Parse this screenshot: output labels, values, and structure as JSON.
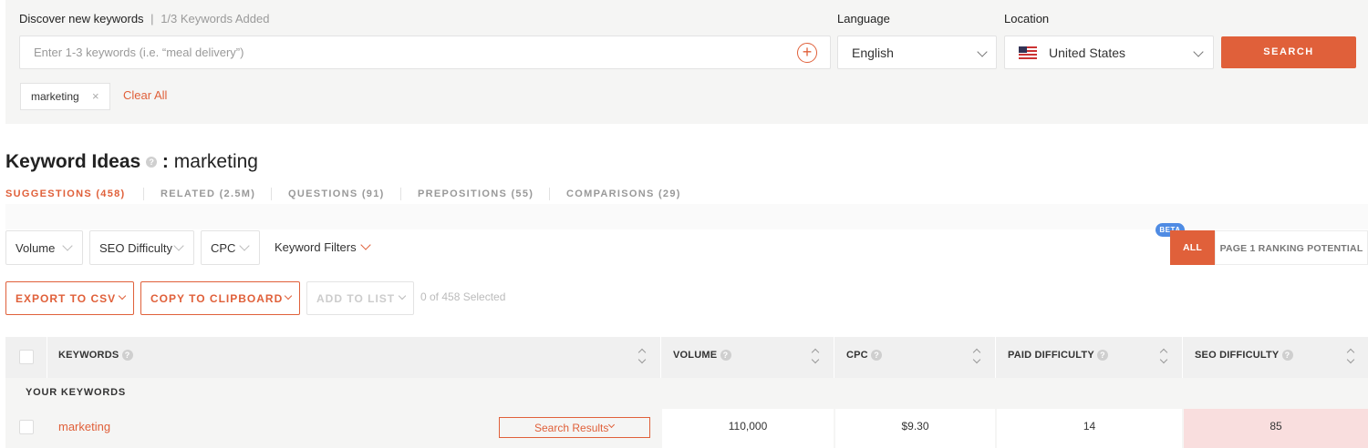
{
  "search": {
    "discover_label": "Discover new keywords",
    "keywords_added": "1/3 Keywords Added",
    "placeholder": "Enter 1-3 keywords (i.e. “meal delivery”)",
    "language_label": "Language",
    "language_value": "English",
    "location_label": "Location",
    "location_value": "United States",
    "search_button": "SEARCH",
    "chips": [
      "marketing"
    ],
    "clear_all": "Clear All"
  },
  "heading": {
    "title": "Keyword Ideas",
    "separator": ":",
    "keyword": "marketing"
  },
  "tabs": [
    {
      "label": "SUGGESTIONS (458)",
      "active": true
    },
    {
      "label": "RELATED (2.5M)",
      "active": false
    },
    {
      "label": "QUESTIONS (91)",
      "active": false
    },
    {
      "label": "PREPOSITIONS (55)",
      "active": false
    },
    {
      "label": "COMPARISONS (29)",
      "active": false
    }
  ],
  "filters": {
    "volume": "Volume",
    "seo_difficulty": "SEO Difficulty",
    "cpc": "CPC",
    "keyword_filters": "Keyword Filters",
    "beta_badge": "BETA",
    "segment_all": "ALL",
    "segment_page1": "PAGE 1 RANKING POTENTIAL"
  },
  "actions": {
    "export_csv": "EXPORT TO CSV",
    "copy_clipboard": "COPY TO CLIPBOARD",
    "add_to_list": "ADD TO LIST",
    "selected_count": "0 of 458 Selected"
  },
  "table": {
    "columns": [
      "KEYWORDS",
      "VOLUME",
      "CPC",
      "PAID DIFFICULTY",
      "SEO DIFFICULTY"
    ],
    "group_label": "YOUR KEYWORDS",
    "rows": [
      {
        "keyword": "marketing",
        "search_results": "Search Results",
        "volume": "110,000",
        "cpc": "$9.30",
        "paid_difficulty": "14",
        "seo_difficulty": "85"
      }
    ]
  },
  "colors": {
    "accent": "#e0603a",
    "beta": "#4f8be3",
    "seo_high_bg": "#f9dede"
  }
}
